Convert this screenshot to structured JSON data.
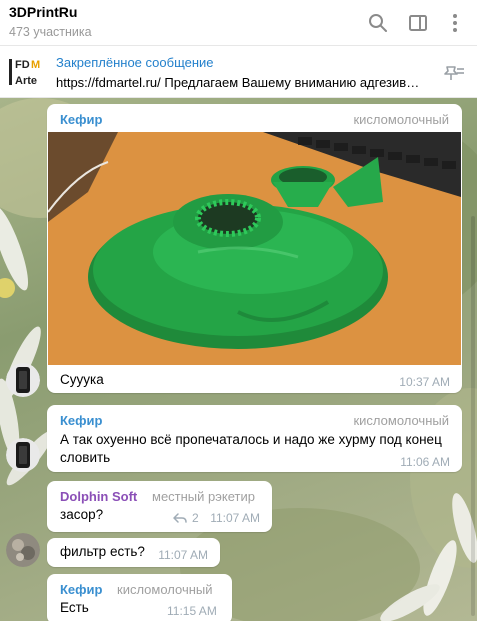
{
  "header": {
    "title": "3DPrintRu",
    "subtitle": "473 участника",
    "icons": [
      "search-icon",
      "sidebar-toggle-icon",
      "more-vertical-icon"
    ]
  },
  "pinned": {
    "title": "Закреплённое сообщение",
    "text": "https://fdmartel.ru/  Предлагаем Вашему вниманию адгезив Fdmartel",
    "thumb_label": "FDM Arte",
    "icon": "unpin-icon"
  },
  "messages": [
    {
      "author": "Кефир",
      "role": "кисломолочный",
      "has_photo": true,
      "text": "Сууука",
      "time": "10:37 AM"
    },
    {
      "author": "Кефир",
      "role": "кисломолочный",
      "text_line1": "А так охуенно всё пропечаталось и надо же хурму под конец",
      "text_line2": "словить",
      "time": "11:06 AM"
    },
    {
      "author": "Dolphin Soft",
      "role": "местный рэкетир",
      "text": "засор?",
      "replies": "2",
      "time": "11:07 AM"
    },
    {
      "text": "фильтр есть?",
      "time": "11:07 AM"
    },
    {
      "author": "Кефир",
      "role": "кисломолочный",
      "text": "Есть",
      "time": "11:15 AM"
    }
  ],
  "colors": {
    "accent": "#2481cc",
    "kefir_name": "#3a8fd0",
    "dolphin_name": "#8b4fb7",
    "time": "#a0acb6"
  }
}
